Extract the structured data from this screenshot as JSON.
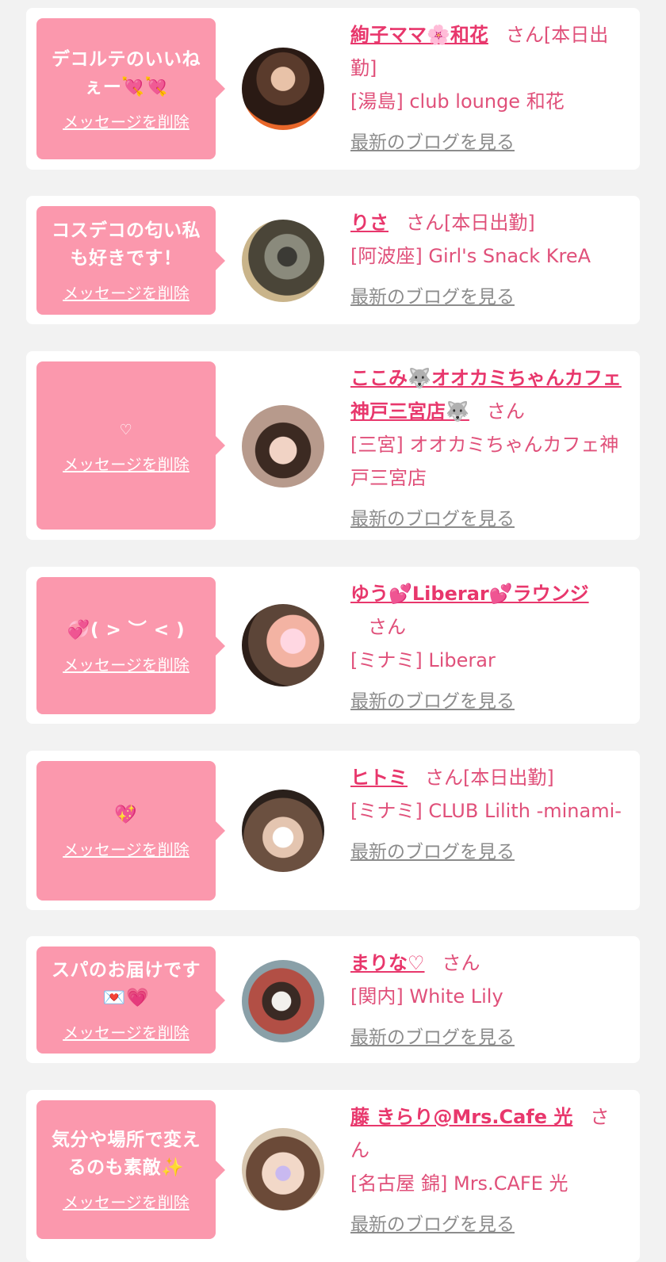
{
  "cards": [
    {
      "message": "デコルテのいいねぇー💘💘",
      "delete_label": "メッセージを削除",
      "name": "絢子ママ🌸和花",
      "suffix": "さん[本日出勤]",
      "shop": "[湯島] club lounge 和花",
      "blog_label": "最新のブログを見る"
    },
    {
      "message": "コスデコの匂い私も好きです！",
      "delete_label": "メッセージを削除",
      "name": "りさ",
      "suffix": "さん[本日出勤]",
      "shop": "[阿波座] Girl's Snack KreA",
      "blog_label": "最新のブログを見る"
    },
    {
      "message": "♡",
      "delete_label": "メッセージを削除",
      "name": "ここみ🐺オオカミちゃんカフェ神戸三宮店🐺",
      "suffix": "さん",
      "shop": "[三宮] オオカミちゃんカフェ神戸三宮店",
      "blog_label": "最新のブログを見る"
    },
    {
      "message": "💞( > ︶ < )",
      "delete_label": "メッセージを削除",
      "name": "ゆう💕Liberar💕ラウンジ",
      "suffix": "さん",
      "shop": "[ミナミ] Liberar",
      "blog_label": "最新のブログを見る"
    },
    {
      "message": "💖",
      "delete_label": "メッセージを削除",
      "name": "ヒトミ",
      "suffix": "さん[本日出勤]",
      "shop": "[ミナミ] CLUB Lilith -minami-",
      "blog_label": "最新のブログを見る"
    },
    {
      "message": "スパのお届けです💌💗",
      "delete_label": "メッセージを削除",
      "name": "まりな♡",
      "suffix": "さん",
      "shop": "[関内] White Lily",
      "blog_label": "最新のブログを見る"
    },
    {
      "message": "気分や場所で変えるのも素敵✨",
      "delete_label": "メッセージを削除",
      "name": "藤 きらり@Mrs.Cafe 光",
      "suffix": "さん",
      "shop": "[名古屋 錦] Mrs.CAFE 光",
      "blog_label": "最新のブログを見る"
    }
  ]
}
